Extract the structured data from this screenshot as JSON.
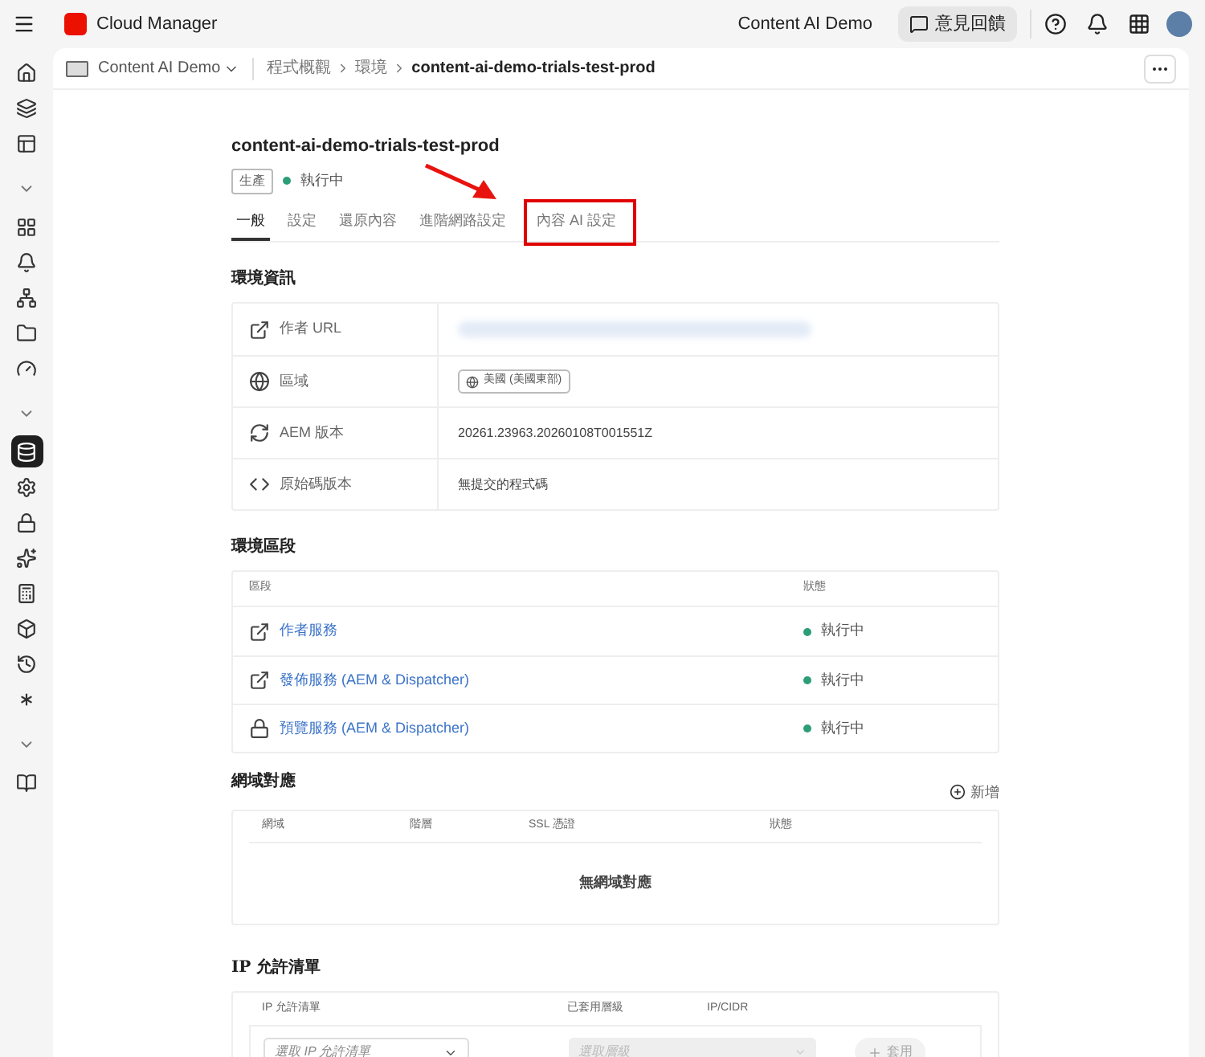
{
  "app": {
    "name": "Cloud Manager",
    "org": "Content AI Demo",
    "feedback": "意見回饋"
  },
  "sidebar": [
    {
      "kind": "nav",
      "selected": false
    },
    {
      "kind": "nav",
      "selected": false
    },
    {
      "kind": "nav",
      "selected": false
    },
    {
      "kind": "toggle",
      "selected": false
    },
    {
      "kind": "nav",
      "selected": false
    },
    {
      "kind": "nav",
      "selected": false
    },
    {
      "kind": "nav",
      "selected": false
    },
    {
      "kind": "nav",
      "selected": false
    },
    {
      "kind": "nav",
      "selected": false
    },
    {
      "kind": "toggle",
      "selected": false
    },
    {
      "kind": "nav",
      "selected": true
    },
    {
      "kind": "nav",
      "selected": false
    },
    {
      "kind": "nav",
      "selected": false
    },
    {
      "kind": "nav",
      "selected": false
    },
    {
      "kind": "nav",
      "selected": false
    },
    {
      "kind": "nav",
      "selected": false
    },
    {
      "kind": "nav",
      "selected": false
    },
    {
      "kind": "nav",
      "selected": false
    },
    {
      "kind": "toggle",
      "selected": false
    },
    {
      "kind": "nav",
      "selected": false
    }
  ],
  "breadcrumb": {
    "program": "Content AI Demo",
    "items": [
      "程式概觀",
      "環境",
      "content-ai-demo-trials-test-prod"
    ]
  },
  "environment": {
    "title": "content-ai-demo-trials-test-prod",
    "badge": "生產",
    "status": "執行中"
  },
  "tabs": [
    {
      "label": "一般",
      "selected": true
    },
    {
      "label": "設定",
      "selected": false
    },
    {
      "label": "還原內容",
      "selected": false
    },
    {
      "label": "進階網路設定",
      "selected": false
    },
    {
      "label": "內容 AI 設定",
      "selected": false,
      "highlighted": true
    }
  ],
  "info": {
    "title": "環境資訊",
    "rows": [
      {
        "kind": "url",
        "label": "作者 URL"
      },
      {
        "kind": "region",
        "label": "區域",
        "value": "美國 (美國東部)"
      },
      {
        "kind": "version",
        "label": "AEM 版本",
        "value": "20261.23963.20260108T001551Z"
      },
      {
        "kind": "code",
        "label": "原始碼版本",
        "value": "無提交的程式碼"
      }
    ]
  },
  "segments": {
    "title": "環境區段",
    "columns": [
      "區段",
      "狀態"
    ],
    "rows": [
      {
        "kind": "external",
        "name": "作者服務",
        "status": "執行中"
      },
      {
        "kind": "external",
        "name": "發佈服務 (AEM & Dispatcher)",
        "status": "執行中"
      },
      {
        "kind": "locked",
        "name": "預覽服務 (AEM & Dispatcher)",
        "status": "執行中"
      }
    ]
  },
  "domains": {
    "title": "網域對應",
    "add": "新增",
    "columns": [
      "網域",
      "階層",
      "SSL 憑證",
      "狀態"
    ],
    "empty": "無網域對應"
  },
  "ip": {
    "title": "IP 允許清單",
    "columns": [
      "IP 允許清單",
      "已套用層級",
      "IP/CIDR"
    ],
    "select_placeholder": "選取 IP 允許清單",
    "tier_placeholder": "選取層級",
    "apply": "套用"
  }
}
